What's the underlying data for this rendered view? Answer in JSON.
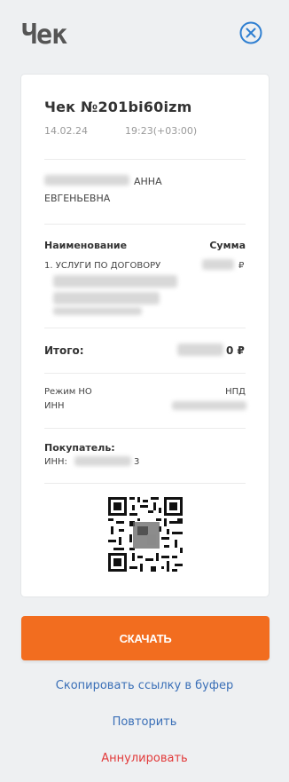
{
  "header": {
    "title": "Чек",
    "close_icon": "close-circle-icon",
    "accent_color": "#2f7fd1"
  },
  "receipt": {
    "number": "Чек №201bi60izm",
    "date": "14.02.24",
    "time": "19:23(+03:00)",
    "client_name_line1_visible": "АННА",
    "client_name_line2": "ЕВГЕНЬЕВНА",
    "columns": {
      "name_header": "Наименование",
      "sum_header": "Сумма"
    },
    "item_text": "1. УСЛУГИ ПО ДОГОВОРУ",
    "item_currency": "₽",
    "total_label": "Итого:",
    "total_value_visible": "0 ₽",
    "tax_mode_label": "Режим НО",
    "tax_mode_value": "НПД",
    "inn_label": "ИНН",
    "buyer_label": "Покупатель:",
    "buyer_inn_label": "ИНН:",
    "buyer_inn_tail": "3"
  },
  "actions": {
    "download_label": "СКАЧАТЬ",
    "download_color": "#f26d1f",
    "copy_link_label": "Скопировать ссылку в буфер",
    "repeat_label": "Повторить",
    "cancel_label": "Аннулировать",
    "link_color": "#3a6fb7",
    "cancel_color": "#e23a3a"
  }
}
